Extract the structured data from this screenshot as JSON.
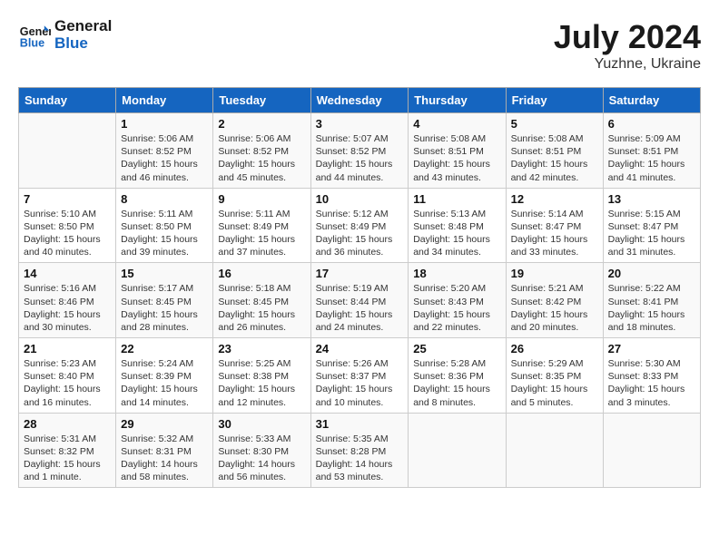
{
  "header": {
    "logo_line1": "General",
    "logo_line2": "Blue",
    "month_title": "July 2024",
    "subtitle": "Yuzhne, Ukraine"
  },
  "columns": [
    "Sunday",
    "Monday",
    "Tuesday",
    "Wednesday",
    "Thursday",
    "Friday",
    "Saturday"
  ],
  "weeks": [
    [
      {
        "day": "",
        "lines": []
      },
      {
        "day": "1",
        "lines": [
          "Sunrise: 5:06 AM",
          "Sunset: 8:52 PM",
          "Daylight: 15 hours",
          "and 46 minutes."
        ]
      },
      {
        "day": "2",
        "lines": [
          "Sunrise: 5:06 AM",
          "Sunset: 8:52 PM",
          "Daylight: 15 hours",
          "and 45 minutes."
        ]
      },
      {
        "day": "3",
        "lines": [
          "Sunrise: 5:07 AM",
          "Sunset: 8:52 PM",
          "Daylight: 15 hours",
          "and 44 minutes."
        ]
      },
      {
        "day": "4",
        "lines": [
          "Sunrise: 5:08 AM",
          "Sunset: 8:51 PM",
          "Daylight: 15 hours",
          "and 43 minutes."
        ]
      },
      {
        "day": "5",
        "lines": [
          "Sunrise: 5:08 AM",
          "Sunset: 8:51 PM",
          "Daylight: 15 hours",
          "and 42 minutes."
        ]
      },
      {
        "day": "6",
        "lines": [
          "Sunrise: 5:09 AM",
          "Sunset: 8:51 PM",
          "Daylight: 15 hours",
          "and 41 minutes."
        ]
      }
    ],
    [
      {
        "day": "7",
        "lines": [
          "Sunrise: 5:10 AM",
          "Sunset: 8:50 PM",
          "Daylight: 15 hours",
          "and 40 minutes."
        ]
      },
      {
        "day": "8",
        "lines": [
          "Sunrise: 5:11 AM",
          "Sunset: 8:50 PM",
          "Daylight: 15 hours",
          "and 39 minutes."
        ]
      },
      {
        "day": "9",
        "lines": [
          "Sunrise: 5:11 AM",
          "Sunset: 8:49 PM",
          "Daylight: 15 hours",
          "and 37 minutes."
        ]
      },
      {
        "day": "10",
        "lines": [
          "Sunrise: 5:12 AM",
          "Sunset: 8:49 PM",
          "Daylight: 15 hours",
          "and 36 minutes."
        ]
      },
      {
        "day": "11",
        "lines": [
          "Sunrise: 5:13 AM",
          "Sunset: 8:48 PM",
          "Daylight: 15 hours",
          "and 34 minutes."
        ]
      },
      {
        "day": "12",
        "lines": [
          "Sunrise: 5:14 AM",
          "Sunset: 8:47 PM",
          "Daylight: 15 hours",
          "and 33 minutes."
        ]
      },
      {
        "day": "13",
        "lines": [
          "Sunrise: 5:15 AM",
          "Sunset: 8:47 PM",
          "Daylight: 15 hours",
          "and 31 minutes."
        ]
      }
    ],
    [
      {
        "day": "14",
        "lines": [
          "Sunrise: 5:16 AM",
          "Sunset: 8:46 PM",
          "Daylight: 15 hours",
          "and 30 minutes."
        ]
      },
      {
        "day": "15",
        "lines": [
          "Sunrise: 5:17 AM",
          "Sunset: 8:45 PM",
          "Daylight: 15 hours",
          "and 28 minutes."
        ]
      },
      {
        "day": "16",
        "lines": [
          "Sunrise: 5:18 AM",
          "Sunset: 8:45 PM",
          "Daylight: 15 hours",
          "and 26 minutes."
        ]
      },
      {
        "day": "17",
        "lines": [
          "Sunrise: 5:19 AM",
          "Sunset: 8:44 PM",
          "Daylight: 15 hours",
          "and 24 minutes."
        ]
      },
      {
        "day": "18",
        "lines": [
          "Sunrise: 5:20 AM",
          "Sunset: 8:43 PM",
          "Daylight: 15 hours",
          "and 22 minutes."
        ]
      },
      {
        "day": "19",
        "lines": [
          "Sunrise: 5:21 AM",
          "Sunset: 8:42 PM",
          "Daylight: 15 hours",
          "and 20 minutes."
        ]
      },
      {
        "day": "20",
        "lines": [
          "Sunrise: 5:22 AM",
          "Sunset: 8:41 PM",
          "Daylight: 15 hours",
          "and 18 minutes."
        ]
      }
    ],
    [
      {
        "day": "21",
        "lines": [
          "Sunrise: 5:23 AM",
          "Sunset: 8:40 PM",
          "Daylight: 15 hours",
          "and 16 minutes."
        ]
      },
      {
        "day": "22",
        "lines": [
          "Sunrise: 5:24 AM",
          "Sunset: 8:39 PM",
          "Daylight: 15 hours",
          "and 14 minutes."
        ]
      },
      {
        "day": "23",
        "lines": [
          "Sunrise: 5:25 AM",
          "Sunset: 8:38 PM",
          "Daylight: 15 hours",
          "and 12 minutes."
        ]
      },
      {
        "day": "24",
        "lines": [
          "Sunrise: 5:26 AM",
          "Sunset: 8:37 PM",
          "Daylight: 15 hours",
          "and 10 minutes."
        ]
      },
      {
        "day": "25",
        "lines": [
          "Sunrise: 5:28 AM",
          "Sunset: 8:36 PM",
          "Daylight: 15 hours",
          "and 8 minutes."
        ]
      },
      {
        "day": "26",
        "lines": [
          "Sunrise: 5:29 AM",
          "Sunset: 8:35 PM",
          "Daylight: 15 hours",
          "and 5 minutes."
        ]
      },
      {
        "day": "27",
        "lines": [
          "Sunrise: 5:30 AM",
          "Sunset: 8:33 PM",
          "Daylight: 15 hours",
          "and 3 minutes."
        ]
      }
    ],
    [
      {
        "day": "28",
        "lines": [
          "Sunrise: 5:31 AM",
          "Sunset: 8:32 PM",
          "Daylight: 15 hours",
          "and 1 minute."
        ]
      },
      {
        "day": "29",
        "lines": [
          "Sunrise: 5:32 AM",
          "Sunset: 8:31 PM",
          "Daylight: 14 hours",
          "and 58 minutes."
        ]
      },
      {
        "day": "30",
        "lines": [
          "Sunrise: 5:33 AM",
          "Sunset: 8:30 PM",
          "Daylight: 14 hours",
          "and 56 minutes."
        ]
      },
      {
        "day": "31",
        "lines": [
          "Sunrise: 5:35 AM",
          "Sunset: 8:28 PM",
          "Daylight: 14 hours",
          "and 53 minutes."
        ]
      },
      {
        "day": "",
        "lines": []
      },
      {
        "day": "",
        "lines": []
      },
      {
        "day": "",
        "lines": []
      }
    ]
  ]
}
